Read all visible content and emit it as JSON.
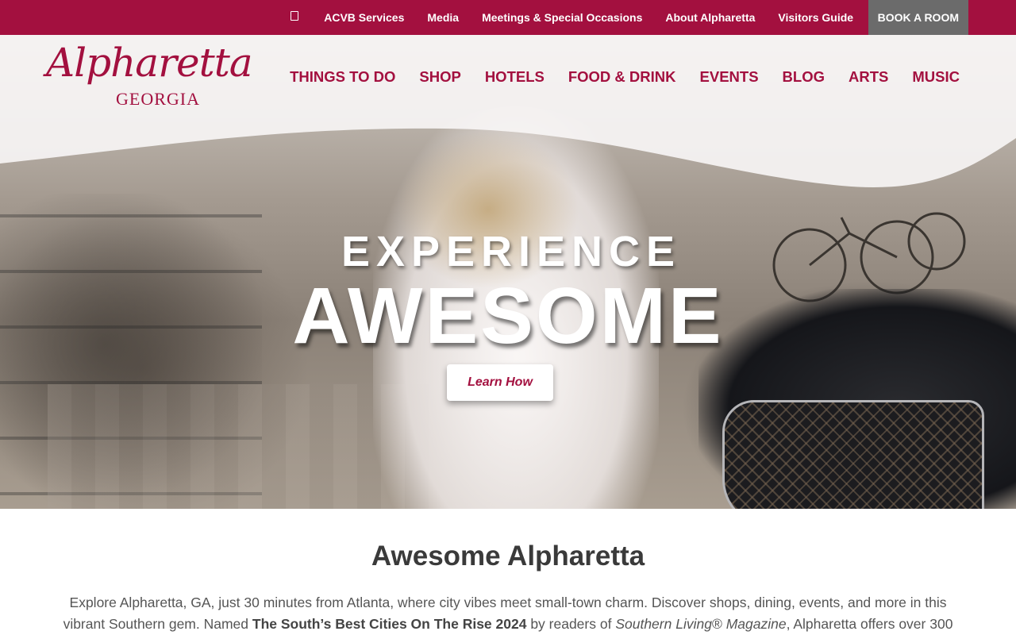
{
  "topbar": {
    "links": [
      "ACVB Services",
      "Media",
      "Meetings & Special Occasions",
      "About Alpharetta",
      "Visitors Guide"
    ],
    "book_label": "BOOK A ROOM",
    "icon": "bookmark-icon"
  },
  "logo": {
    "script": "Alpharetta",
    "state": "GEORGIA"
  },
  "nav": {
    "items": [
      "THINGS TO DO",
      "SHOP",
      "HOTELS",
      "FOOD & DRINK",
      "EVENTS",
      "BLOG",
      "ARTS",
      "MUSIC"
    ]
  },
  "hero": {
    "line1": "EXPERIENCE",
    "line2": "AWESOME",
    "cta_label": "Learn How"
  },
  "intro": {
    "title": "Awesome Alpharetta",
    "p1": "Explore Alpharetta, GA, just 30 minutes from Atlanta, where city vibes meet small-town charm. Discover shops, dining, events, and more in this vibrant Southern gem. Named ",
    "p_strong": "The South’s Best Cities On The Rise 2024",
    "p2": " by readers of ",
    "p_em": "Southern Living",
    "p3": "® ",
    "p_em2": "Magazine",
    "p4": ", Alpharetta offers over 300"
  },
  "colors": {
    "brand": "#a3103f",
    "book_bg": "#6b6b6b",
    "heading": "#3a3a3a"
  }
}
